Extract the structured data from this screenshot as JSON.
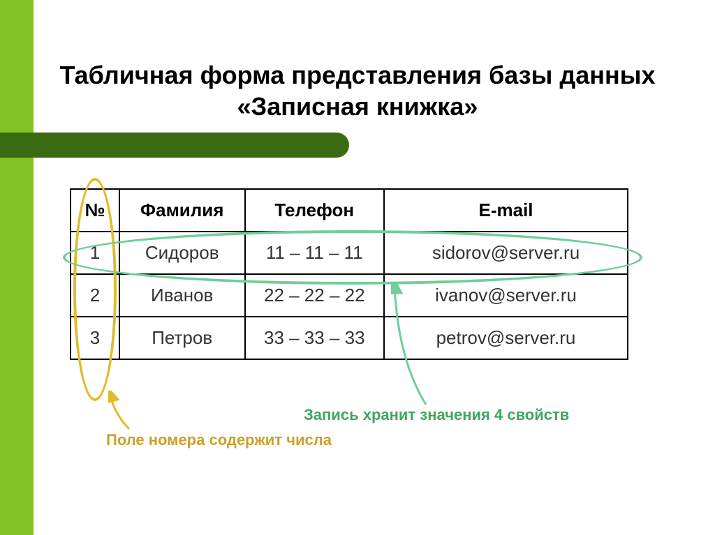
{
  "title": "Табличная форма представления базы данных «Записная книжка»",
  "headers": {
    "num": "№",
    "surname": "Фамилия",
    "phone": "Телефон",
    "email": "E-mail"
  },
  "rows": [
    {
      "num": "1",
      "surname": "Сидоров",
      "phone": "11 – 11 – 11",
      "email": "sidorov@server.ru"
    },
    {
      "num": "2",
      "surname": "Иванов",
      "phone": "22 – 22 – 22",
      "email": "ivanov@server.ru"
    },
    {
      "num": "3",
      "surname": "Петров",
      "phone": "33 – 33 – 33",
      "email": "petrov@server.ru"
    }
  ],
  "annotations": {
    "record": "Запись хранит значения 4 свойств",
    "field": "Поле номера содержит числа"
  },
  "chart_data": {
    "type": "table",
    "title": "Табличная форма представления базы данных «Записная книжка»",
    "columns": [
      "№",
      "Фамилия",
      "Телефон",
      "E-mail"
    ],
    "rows": [
      [
        "1",
        "Сидоров",
        "11 – 11 – 11",
        "sidorov@server.ru"
      ],
      [
        "2",
        "Иванов",
        "22 – 22 – 22",
        "ivanov@server.ru"
      ],
      [
        "3",
        "Петров",
        "33 – 33 – 33",
        "petrov@server.ru"
      ]
    ],
    "callouts": [
      {
        "target": "row 1",
        "label": "Запись хранит значения 4 свойств",
        "color": "#3fa65f"
      },
      {
        "target": "column №",
        "label": "Поле номера содержит числа",
        "color": "#cca02a"
      }
    ]
  }
}
